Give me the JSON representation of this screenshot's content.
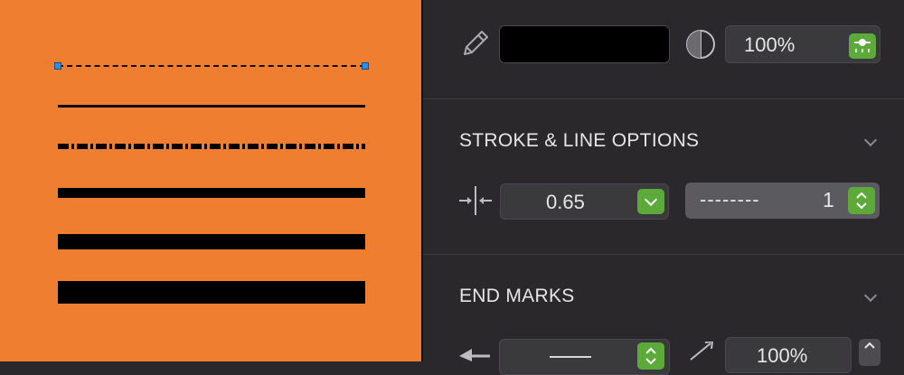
{
  "fill": {
    "opacity_value": "100%"
  },
  "stroke_section": {
    "title": "STROKE & LINE OPTIONS",
    "width_value": "0.65",
    "dash_pattern": "--------",
    "dash_value": "1"
  },
  "end_marks": {
    "title": "END MARKS",
    "scale_value": "100%"
  },
  "colors": {
    "canvas": "#ef7e31",
    "panel": "#2a282b",
    "accent_green": "#5cab3a",
    "selection_handle": "#2f8fe0"
  },
  "icons": [
    "pencil-icon",
    "opacity-icon",
    "stroke-width-icon",
    "arrow-start-icon",
    "resize-icon",
    "chevron-down-icon"
  ]
}
